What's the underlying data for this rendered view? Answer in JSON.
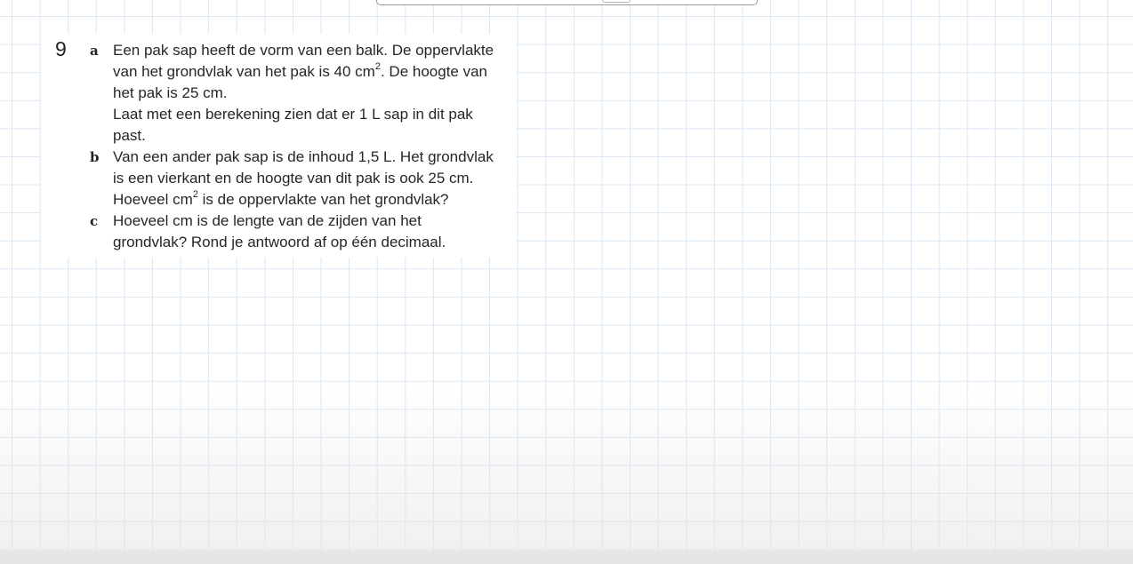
{
  "exercise": {
    "number": "9",
    "parts": [
      {
        "letter": "a",
        "lines": [
          {
            "text": "Een pak sap heeft de vorm van een balk. De oppervlakte"
          },
          {
            "text": "van het grondvlak van het pak is 40 cm",
            "sup": "2",
            "after": ". De hoogte van"
          },
          {
            "text": "het pak is 25 cm."
          },
          {
            "text": "Laat met een berekening zien dat er 1 L sap in dit pak"
          },
          {
            "text": "past."
          }
        ]
      },
      {
        "letter": "b",
        "lines": [
          {
            "text": "Van een ander pak sap is de inhoud 1,5 L. Het grondvlak"
          },
          {
            "text": "is een vierkant en de hoogte van dit pak is ook 25 cm."
          },
          {
            "text": "Hoeveel cm",
            "sup": "2",
            "after": " is de oppervlakte van het grondvlak?"
          }
        ]
      },
      {
        "letter": "c",
        "lines": [
          {
            "text": "Hoeveel cm is de lengte van de zijden van het"
          },
          {
            "text": "grondvlak? Rond je antwoord af op één decimaal."
          }
        ]
      }
    ]
  }
}
